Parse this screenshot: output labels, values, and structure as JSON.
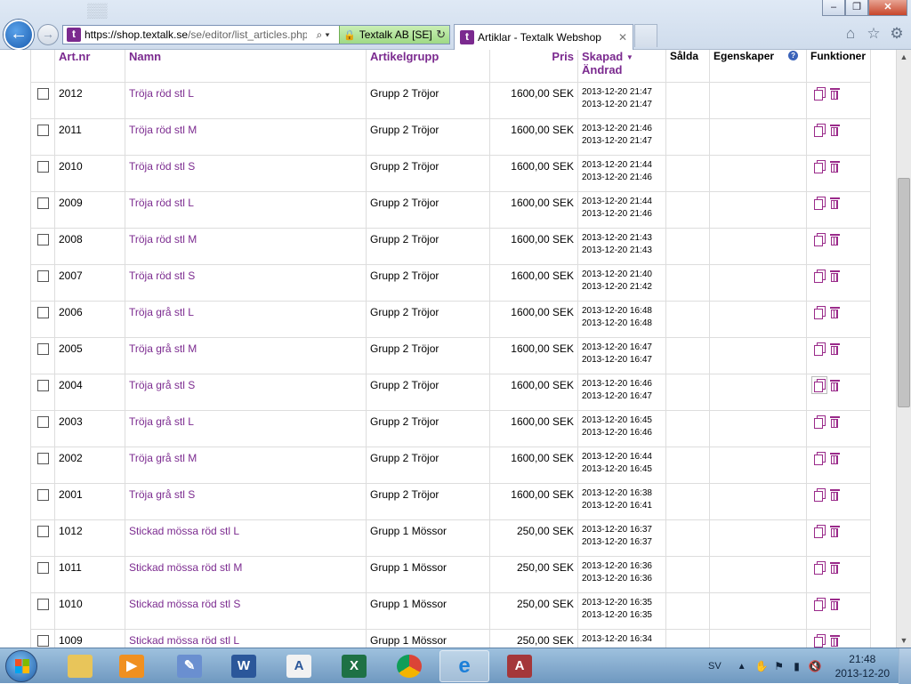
{
  "browser": {
    "url_host": "https://shop.textalk.se",
    "url_path": "/se/editor/list_articles.php",
    "cert_label": "Textalk AB [SE]",
    "tab_title": "Artiklar - Textalk Webshop",
    "favicon_letter": "t"
  },
  "table": {
    "headers": {
      "artnr": "Art.nr",
      "namn": "Namn",
      "artikelgrupp": "Artikelgrupp",
      "pris": "Pris",
      "skapad": "Skapad",
      "andrad": "Ändrad",
      "salda": "Sålda",
      "egenskaper": "Egenskaper",
      "funktioner": "Funktioner"
    },
    "rows": [
      {
        "artnr": "2012",
        "namn": "Tröja röd stl L",
        "grupp": "Grupp 2 Tröjor",
        "pris": "1600,00 SEK",
        "skapad": "2013-12-20 21:47",
        "andrad": "2013-12-20 21:47"
      },
      {
        "artnr": "2011",
        "namn": "Tröja röd stl M",
        "grupp": "Grupp 2 Tröjor",
        "pris": "1600,00 SEK",
        "skapad": "2013-12-20 21:46",
        "andrad": "2013-12-20 21:47"
      },
      {
        "artnr": "2010",
        "namn": "Tröja röd stl S",
        "grupp": "Grupp 2 Tröjor",
        "pris": "1600,00 SEK",
        "skapad": "2013-12-20 21:44",
        "andrad": "2013-12-20 21:46"
      },
      {
        "artnr": "2009",
        "namn": "Tröja röd stl L",
        "grupp": "Grupp 2 Tröjor",
        "pris": "1600,00 SEK",
        "skapad": "2013-12-20 21:44",
        "andrad": "2013-12-20 21:46"
      },
      {
        "artnr": "2008",
        "namn": "Tröja röd stl M",
        "grupp": "Grupp 2 Tröjor",
        "pris": "1600,00 SEK",
        "skapad": "2013-12-20 21:43",
        "andrad": "2013-12-20 21:43"
      },
      {
        "artnr": "2007",
        "namn": "Tröja röd stl S",
        "grupp": "Grupp 2 Tröjor",
        "pris": "1600,00 SEK",
        "skapad": "2013-12-20 21:40",
        "andrad": "2013-12-20 21:42"
      },
      {
        "artnr": "2006",
        "namn": "Tröja grå stl L",
        "grupp": "Grupp 2 Tröjor",
        "pris": "1600,00 SEK",
        "skapad": "2013-12-20 16:48",
        "andrad": "2013-12-20 16:48"
      },
      {
        "artnr": "2005",
        "namn": "Tröja grå stl M",
        "grupp": "Grupp 2 Tröjor",
        "pris": "1600,00 SEK",
        "skapad": "2013-12-20 16:47",
        "andrad": "2013-12-20 16:47"
      },
      {
        "artnr": "2004",
        "namn": "Tröja grå stl S",
        "grupp": "Grupp 2 Tröjor",
        "pris": "1600,00 SEK",
        "skapad": "2013-12-20 16:46",
        "andrad": "2013-12-20 16:47"
      },
      {
        "artnr": "2003",
        "namn": "Tröja grå stl L",
        "grupp": "Grupp 2 Tröjor",
        "pris": "1600,00 SEK",
        "skapad": "2013-12-20 16:45",
        "andrad": "2013-12-20 16:46"
      },
      {
        "artnr": "2002",
        "namn": "Tröja grå stl M",
        "grupp": "Grupp 2 Tröjor",
        "pris": "1600,00 SEK",
        "skapad": "2013-12-20 16:44",
        "andrad": "2013-12-20 16:45"
      },
      {
        "artnr": "2001",
        "namn": "Tröja grå stl S",
        "grupp": "Grupp 2 Tröjor",
        "pris": "1600,00 SEK",
        "skapad": "2013-12-20 16:38",
        "andrad": "2013-12-20 16:41"
      },
      {
        "artnr": "1012",
        "namn": "Stickad mössa röd stl L",
        "grupp": "Grupp 1 Mössor",
        "pris": "250,00 SEK",
        "skapad": "2013-12-20 16:37",
        "andrad": "2013-12-20 16:37"
      },
      {
        "artnr": "1011",
        "namn": "Stickad mössa röd stl M",
        "grupp": "Grupp 1 Mössor",
        "pris": "250,00 SEK",
        "skapad": "2013-12-20 16:36",
        "andrad": "2013-12-20 16:36"
      },
      {
        "artnr": "1010",
        "namn": "Stickad mössa röd stl S",
        "grupp": "Grupp 1 Mössor",
        "pris": "250,00 SEK",
        "skapad": "2013-12-20 16:35",
        "andrad": "2013-12-20 16:35"
      },
      {
        "artnr": "1009",
        "namn": "Stickad mössa röd stl L",
        "grupp": "Grupp 1 Mössor",
        "pris": "250,00 SEK",
        "skapad": "2013-12-20 16:34",
        "andrad": ""
      }
    ]
  },
  "taskbar": {
    "apps": [
      "file-explorer-icon",
      "media-player-icon",
      "paint-icon",
      "word-icon",
      "wordpad-icon",
      "excel-icon",
      "chrome-icon",
      "internet-explorer-icon",
      "access-icon"
    ],
    "lang": "SV",
    "time": "21:48",
    "date": "2013-12-20"
  },
  "colors": {
    "link": "#7b2a8f",
    "accent": "#9a2a8a"
  }
}
